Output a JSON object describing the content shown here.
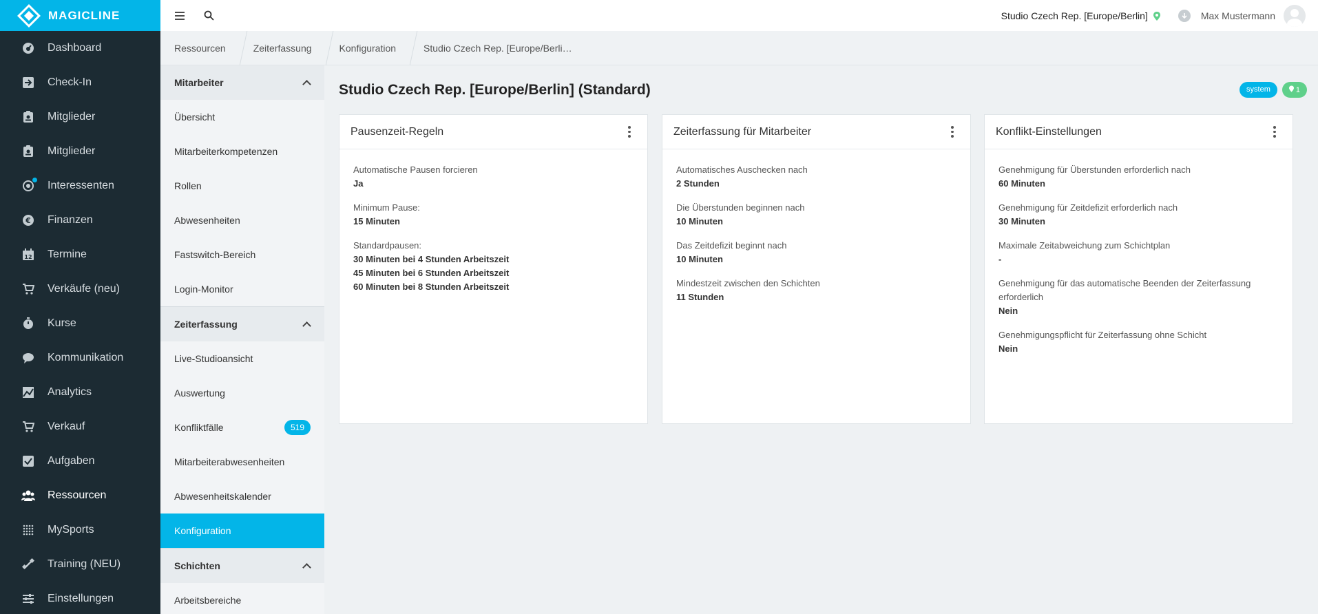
{
  "brand": {
    "name": "MAGICLINE"
  },
  "nav": [
    {
      "label": "Dashboard",
      "icon": "dashboard-icon"
    },
    {
      "label": "Check-In",
      "icon": "check-in-icon"
    },
    {
      "label": "Mitglieder",
      "icon": "member-card-icon"
    },
    {
      "label": "Mitglieder",
      "icon": "member-card-icon"
    },
    {
      "label": "Interessenten",
      "icon": "interested-icon"
    },
    {
      "label": "Finanzen",
      "icon": "euro-icon"
    },
    {
      "label": "Termine",
      "icon": "calendar-icon"
    },
    {
      "label": "Verkäufe (neu)",
      "icon": "cart-icon"
    },
    {
      "label": "Kurse",
      "icon": "timer-icon"
    },
    {
      "label": "Kommunikation",
      "icon": "chat-icon"
    },
    {
      "label": "Analytics",
      "icon": "chart-icon"
    },
    {
      "label": "Verkauf",
      "icon": "cart-icon"
    },
    {
      "label": "Aufgaben",
      "icon": "checkbox-icon"
    },
    {
      "label": "Ressourcen",
      "icon": "people-icon"
    },
    {
      "label": "MySports",
      "icon": "dots-grid-icon"
    },
    {
      "label": "Training (NEU)",
      "icon": "dumbbell-icon"
    },
    {
      "label": "Einstellungen",
      "icon": "sliders-icon"
    }
  ],
  "topbar": {
    "studio": "Studio Czech Rep. [Europe/Berlin]",
    "user": "Max Mustermann"
  },
  "breadcrumb": [
    "Ressourcen",
    "Zeiterfassung",
    "Konfiguration",
    "Studio Czech Rep. [Europe/Berli…"
  ],
  "subnav": {
    "mitarbeiter": {
      "title": "Mitarbeiter",
      "items": [
        "Übersicht",
        "Mitarbeiterkompetenzen",
        "Rollen",
        "Abwesenheiten",
        "Fastswitch-Bereich",
        "Login-Monitor"
      ]
    },
    "zeiterfassung": {
      "title": "Zeiterfassung",
      "items": [
        "Live-Studioansicht",
        "Auswertung",
        "Konfliktfälle",
        "Mitarbeiterabwesenheiten",
        "Abwesenheitskalender",
        "Konfiguration"
      ],
      "konflikt_count": "519"
    },
    "schichten": {
      "title": "Schichten",
      "items": [
        "Arbeitsbereiche"
      ]
    }
  },
  "main": {
    "title": "Studio Czech Rep. [Europe/Berlin] (Standard)",
    "badge_system": "system",
    "badge_count": "1"
  },
  "cards": [
    {
      "title": "Pausenzeit-Regeln",
      "fields": [
        {
          "label": "Automatische Pausen forcieren",
          "value": "Ja"
        },
        {
          "label": "Minimum Pause:",
          "value": "15 Minuten"
        },
        {
          "label": "Standardpausen:",
          "values": [
            "30 Minuten bei 4 Stunden Arbeitszeit",
            "45 Minuten bei 6 Stunden Arbeitszeit",
            "60 Minuten bei 8 Stunden Arbeitszeit"
          ]
        }
      ]
    },
    {
      "title": "Zeiterfassung für Mitarbeiter",
      "fields": [
        {
          "label": "Automatisches Auschecken nach",
          "value": "2 Stunden"
        },
        {
          "label": "Die Überstunden beginnen nach",
          "value": "10 Minuten"
        },
        {
          "label": "Das Zeitdefizit beginnt nach",
          "value": "10 Minuten"
        },
        {
          "label": "Mindestzeit zwischen den Schichten",
          "value": "11 Stunden"
        }
      ]
    },
    {
      "title": "Konflikt-Einstellungen",
      "fields": [
        {
          "label": "Genehmigung für Überstunden erforderlich nach",
          "value": "60 Minuten"
        },
        {
          "label": "Genehmigung für Zeitdefizit erforderlich nach",
          "value": "30 Minuten"
        },
        {
          "label": "Maximale Zeitabweichung zum Schichtplan",
          "value": "-"
        },
        {
          "label": "Genehmigung für das automatische Beenden der Zeiterfassung erforderlich",
          "value": "Nein"
        },
        {
          "label": "Genehmigungspflicht für Zeiterfassung ohne Schicht",
          "value": "Nein"
        }
      ]
    }
  ],
  "colors": {
    "accent": "#03b5e8",
    "nav_bg": "#1c2b33",
    "success": "#5fd08a"
  }
}
